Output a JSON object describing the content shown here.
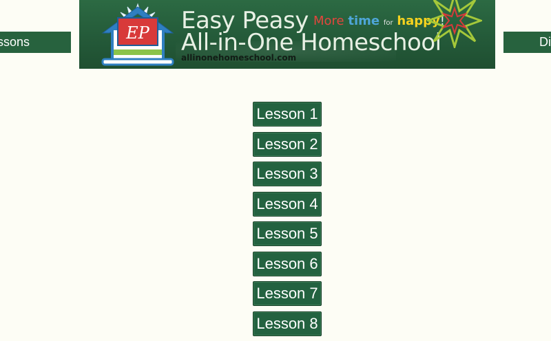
{
  "nav": {
    "left_label": "Lessons",
    "right_label": "Di"
  },
  "banner": {
    "title_line1": "Easy Peasy",
    "title_line2": "All-in-One Homeschool",
    "url": "allinonehomeschool.com",
    "tagline": {
      "more": "More",
      "time": "time",
      "for": "for",
      "happy": "happy",
      "bang": "!"
    },
    "logo_letters": "EP"
  },
  "lessons": [
    {
      "label": "Lesson 1"
    },
    {
      "label": "Lesson 2"
    },
    {
      "label": "Lesson 3"
    },
    {
      "label": "Lesson 4"
    },
    {
      "label": "Lesson 5"
    },
    {
      "label": "Lesson 6"
    },
    {
      "label": "Lesson 7"
    },
    {
      "label": "Lesson 8"
    }
  ],
  "colors": {
    "page_bg": "#fdfdf5",
    "chalkboard_green": "#27623e",
    "button_green": "#236240",
    "logo_blue": "#2f7fc1",
    "logo_red": "#d83a3a"
  }
}
